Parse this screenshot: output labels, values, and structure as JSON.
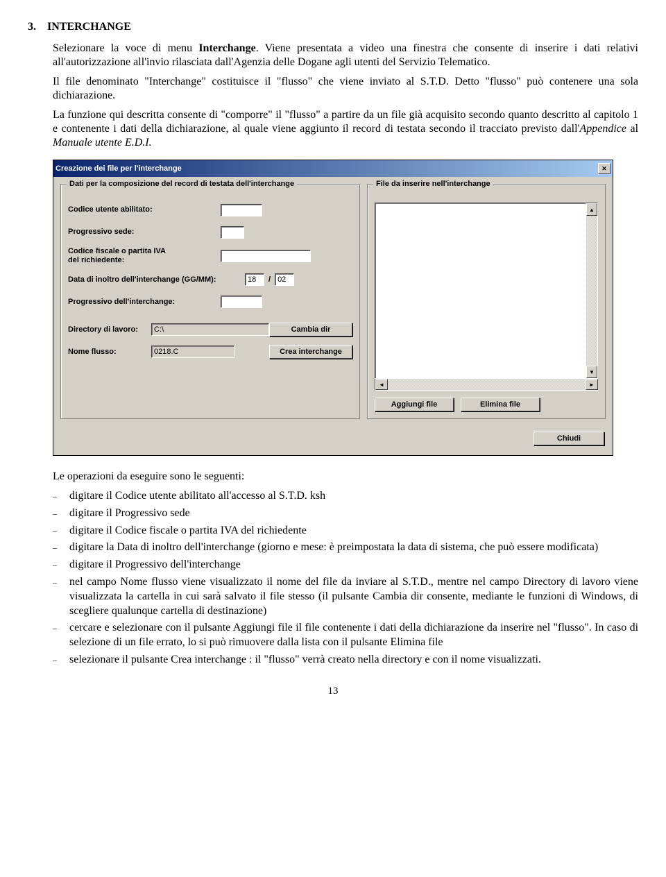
{
  "heading": {
    "num": "3.",
    "title": "INTERCHANGE"
  },
  "p1_a": "Selezionare la voce di menu ",
  "p1_b": "Interchange",
  "p1_c": ". Viene presentata a video una finestra che consente di inserire i dati relativi all'autorizzazione all'invio rilasciata dall'Agenzia delle Dogane agli utenti del Servizio Telematico.",
  "p2": "Il file denominato \"Interchange\" costituisce il \"flusso\" che viene inviato al S.T.D. Detto \"flusso\" può contenere una sola dichiarazione.",
  "p3_a": "La funzione qui descritta consente di \"comporre\" il \"flusso\" a partire da un file già acquisito secondo quanto descritto al capitolo 1 e contenente i dati della dichiarazione, al quale viene aggiunto il record di testata secondo il tracciato previsto dall'",
  "p3_b": "Appendice",
  "p3_c": " al ",
  "p3_d": "Manuale utente E.D.I.",
  "win": {
    "title": "Creazione dei file per l'interchange",
    "left_legend": "Dati per la composizione del record di testata dell'interchange",
    "right_legend": "File da inserire nell'interchange",
    "labels": {
      "codice_utente": "Codice utente abilitato:",
      "progressivo_sede": "Progressivo sede:",
      "cf_piva": "Codice fiscale o partita IVA\ndel richiedente:",
      "data": "Data di inoltro dell'interchange (GG/MM):",
      "progressivo_int": "Progressivo dell'interchange:",
      "directory": "Directory di lavoro:",
      "nome_flusso": "Nome flusso:"
    },
    "values": {
      "gg": "18",
      "mm": "02",
      "directory": "C:\\",
      "nome_flusso": "0218.C"
    },
    "buttons": {
      "cambia_dir": "Cambia dir",
      "crea": "Crea interchange",
      "aggiungi": "Aggiungi file",
      "elimina": "Elimina file",
      "chiudi": "Chiudi"
    }
  },
  "ops_intro": "Le operazioni da eseguire sono le seguenti:",
  "ops": {
    "i1_a": "digitare il ",
    "i1_b": "Codice utente abilitato",
    "i1_c": " all'accesso al S.T.D. ksh",
    "i2_a": "digitare il ",
    "i2_b": "Progressivo sede",
    "i3_a": "digitare il ",
    "i3_b": "Codice fiscale o partita IVA del richiedente",
    "i4_a": "digitare la ",
    "i4_b": "Data di inoltro dell'interchange",
    "i4_c": " (giorno e mese: è preimpostata la data di sistema, che può essere modificata)",
    "i5_a": "digitare il ",
    "i5_b": "Progressivo dell'interchange",
    "i6_a": "nel campo ",
    "i6_b": "Nome flusso",
    "i6_c": " viene visualizzato il nome del file da inviare al S.T.D., mentre nel campo ",
    "i6_d": "Directory di lavoro",
    "i6_e": " viene visualizzata la cartella in cui sarà salvato il file stesso (il pulsante ",
    "i6_f": "Cambia dir",
    "i6_g": " consente, mediante le funzioni di Windows, di scegliere qualunque cartella di destinazione)",
    "i7_a": "cercare e selezionare con il pulsante ",
    "i7_b": "Aggiungi file",
    "i7_c": " il file contenente i dati della dichiarazione da inserire nel \"flusso\". In caso di selezione di un file errato, lo si può rimuovere dalla lista con il pulsante ",
    "i7_d": "Elimina file",
    "i8_a": "selezionare il pulsante ",
    "i8_b": "Crea interchange",
    "i8_c": " : il \"flusso\" verrà creato nella directory e con il nome visualizzati."
  },
  "page_number": "13"
}
